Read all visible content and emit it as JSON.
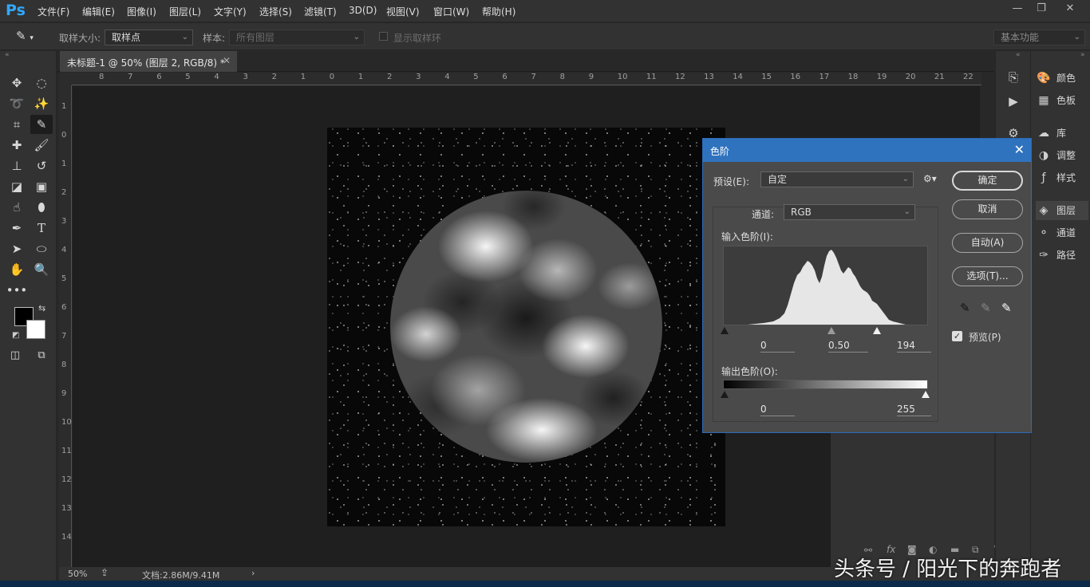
{
  "app": {
    "logo": "Ps"
  },
  "menu": [
    "文件(F)",
    "编辑(E)",
    "图像(I)",
    "图层(L)",
    "文字(Y)",
    "选择(S)",
    "滤镜(T)",
    "3D(D)",
    "视图(V)",
    "窗口(W)",
    "帮助(H)"
  ],
  "window_controls": {
    "minimize": "—",
    "restore": "❐",
    "close": "✕"
  },
  "options": {
    "sample_size_label": "取样大小:",
    "sample_size_value": "取样点",
    "sample_label": "样本:",
    "sample_value": "所有图层",
    "show_ring_label": "显示取样环",
    "workspace": "基本功能"
  },
  "document": {
    "tab_title": "未标题-1 @ 50% (图层 2, RGB/8) *",
    "zoom": "50%",
    "doc_info": "文档:2.86M/9.41M"
  },
  "rulers": {
    "top": [
      "8",
      "7",
      "6",
      "5",
      "4",
      "3",
      "2",
      "1",
      "0",
      "1",
      "2",
      "3",
      "4",
      "5",
      "6",
      "7",
      "8",
      "9",
      "10",
      "11",
      "12",
      "13",
      "14",
      "15",
      "16",
      "17",
      "18",
      "19",
      "20",
      "21",
      "22"
    ],
    "left": [
      "1",
      "0",
      "1",
      "2",
      "3",
      "4",
      "5",
      "6",
      "7",
      "8",
      "9",
      "10",
      "11",
      "12",
      "13",
      "14"
    ]
  },
  "panels": {
    "items": [
      {
        "label": "颜色",
        "icon": "color-icon"
      },
      {
        "label": "色板",
        "icon": "swatches-icon"
      },
      {
        "label": "库",
        "icon": "libraries-icon"
      },
      {
        "label": "调整",
        "icon": "adjustments-icon"
      },
      {
        "label": "样式",
        "icon": "styles-icon"
      },
      {
        "label": "图层",
        "icon": "layers-icon"
      },
      {
        "label": "通道",
        "icon": "channels-icon"
      },
      {
        "label": "路径",
        "icon": "paths-icon"
      }
    ]
  },
  "levels_dialog": {
    "title": "色阶",
    "preset_label": "预设(E):",
    "preset_value": "自定",
    "channel_label": "通道:",
    "channel_value": "RGB",
    "input_levels_label": "输入色阶(I):",
    "input_black": "0",
    "input_gamma": "0.50",
    "input_white": "194",
    "output_levels_label": "输出色阶(O):",
    "output_black": "0",
    "output_white": "255",
    "buttons": {
      "ok": "确定",
      "cancel": "取消",
      "auto": "自动(A)",
      "options": "选项(T)..."
    },
    "preview_label": "预览(P)",
    "preview_checked": true,
    "accent_color": "#2f73bf"
  },
  "watermark": "头条号 / 阳光下的奔跑者"
}
